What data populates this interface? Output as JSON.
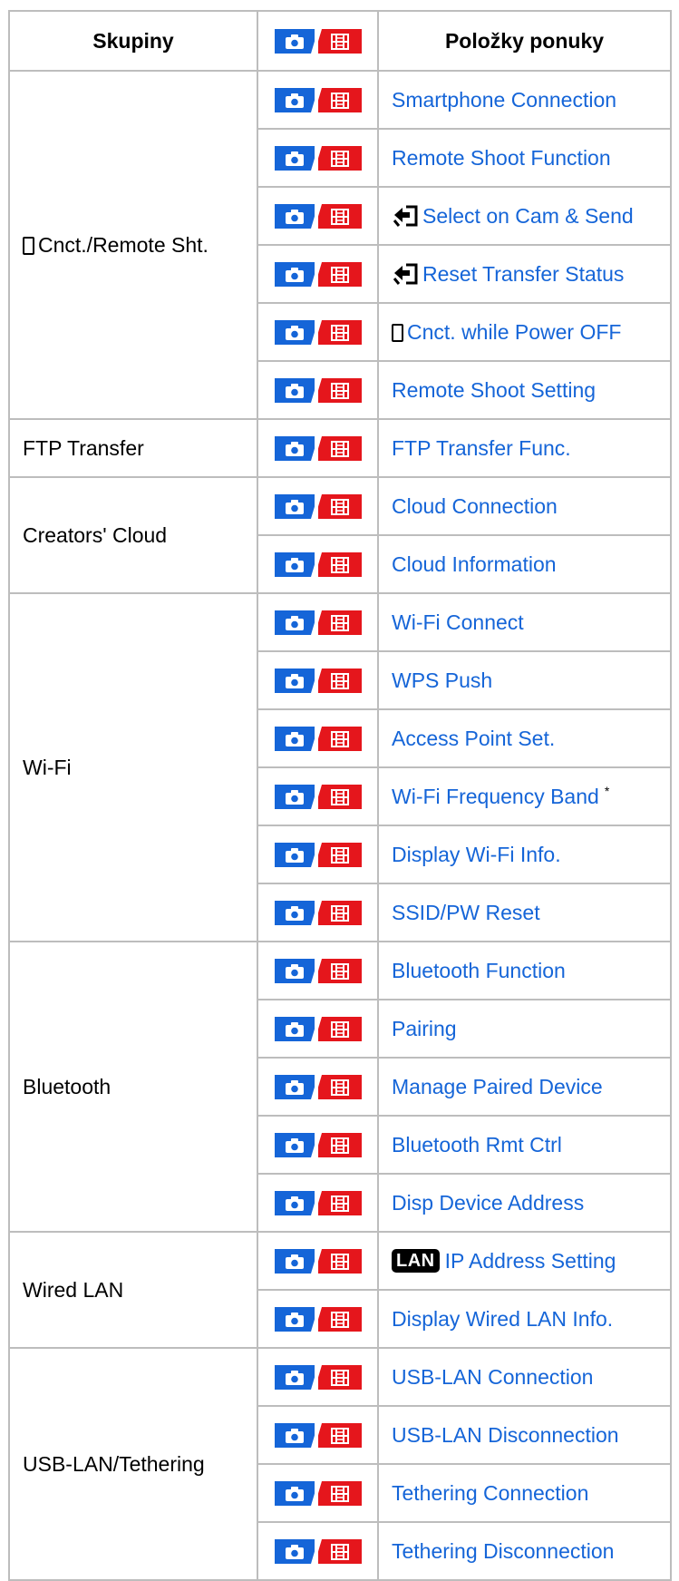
{
  "header": {
    "groups": "Skupiny",
    "items": "Položky ponuky"
  },
  "icons": {
    "still": "camera-icon",
    "movie": "film-icon",
    "smartphone": "smartphone-icon",
    "transfer": "transfer-arrow-icon",
    "lan": "lan-icon"
  },
  "colors": {
    "link": "#1565d8",
    "still_bg": "#1565d8",
    "movie_bg": "#e5161c",
    "border": "#bdbdbd"
  },
  "groups": [
    {
      "label": "Cnct./Remote Sht.",
      "icon": "smartphone-icon",
      "items": [
        {
          "label": "Smartphone Connection"
        },
        {
          "label": "Remote Shoot Function"
        },
        {
          "label": "Select on Cam & Send",
          "icon": "transfer-arrow-icon"
        },
        {
          "label": "Reset Transfer Status",
          "icon": "transfer-arrow-icon"
        },
        {
          "label": "Cnct. while Power OFF",
          "icon": "smartphone-icon"
        },
        {
          "label": "Remote Shoot Setting"
        }
      ]
    },
    {
      "label": "FTP Transfer",
      "items": [
        {
          "label": "FTP Transfer Func."
        }
      ]
    },
    {
      "label": "Creators' Cloud",
      "items": [
        {
          "label": "Cloud Connection"
        },
        {
          "label": "Cloud Information"
        }
      ]
    },
    {
      "label": "Wi-Fi",
      "items": [
        {
          "label": "Wi-Fi Connect"
        },
        {
          "label": "WPS Push"
        },
        {
          "label": "Access Point Set."
        },
        {
          "label": "Wi-Fi Frequency Band",
          "note": "*"
        },
        {
          "label": "Display Wi-Fi Info."
        },
        {
          "label": "SSID/PW Reset"
        }
      ]
    },
    {
      "label": "Bluetooth",
      "items": [
        {
          "label": "Bluetooth Function"
        },
        {
          "label": "Pairing"
        },
        {
          "label": "Manage Paired Device"
        },
        {
          "label": "Bluetooth Rmt Ctrl"
        },
        {
          "label": "Disp Device Address"
        }
      ]
    },
    {
      "label": "Wired LAN",
      "items": [
        {
          "label": "IP Address Setting",
          "icon": "lan-icon",
          "icon_text": "LAN"
        },
        {
          "label": "Display Wired LAN Info."
        }
      ]
    },
    {
      "label": "USB-LAN/Tethering",
      "items": [
        {
          "label": "USB-LAN Connection"
        },
        {
          "label": "USB-LAN Disconnection"
        },
        {
          "label": "Tethering Connection"
        },
        {
          "label": "Tethering Disconnection"
        }
      ]
    }
  ]
}
